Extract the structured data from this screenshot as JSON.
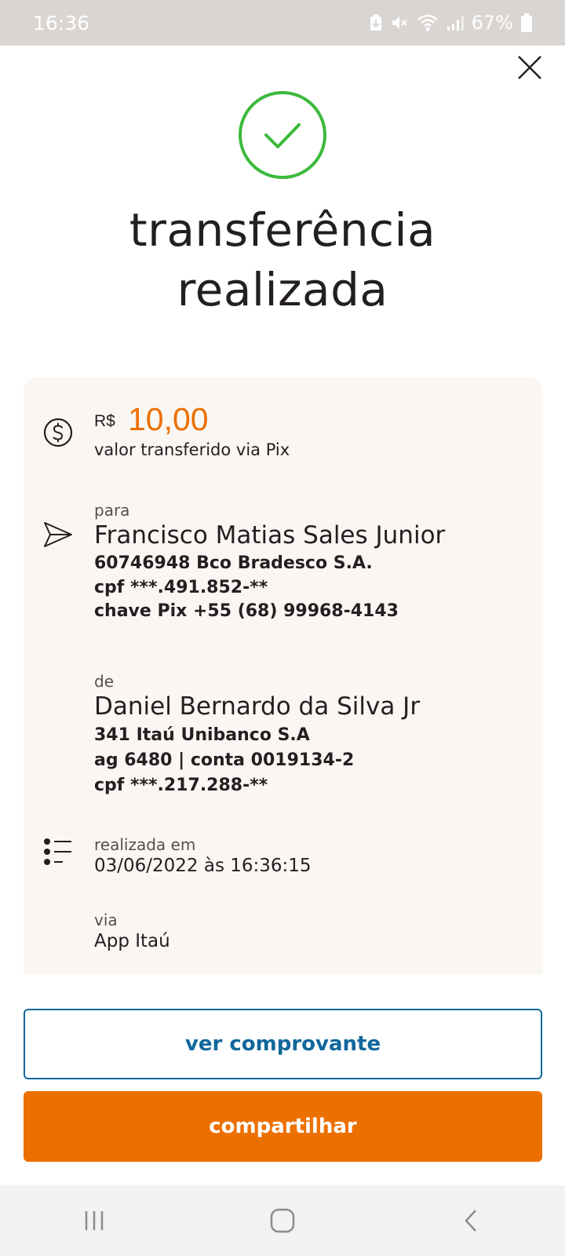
{
  "status_bar": {
    "time": "16:36",
    "battery": "67%",
    "icons": [
      "battery-saver-icon",
      "mute-icon",
      "wifi-icon",
      "signal-icon",
      "battery-icon"
    ]
  },
  "header": {
    "title_line1": "transferência",
    "title_line2": "realizada",
    "close_icon": "close-icon",
    "success_icon": "check-circle-icon"
  },
  "amount": {
    "currency": "R$",
    "value": "10,00",
    "caption": "valor transferido via Pix",
    "icon": "dollar-circle-icon"
  },
  "recipient": {
    "label": "para",
    "name": "Francisco Matias Sales Junior",
    "bank": "60746948 Bco Bradesco S.A.",
    "cpf": "cpf ***.491.852-**",
    "pix_key": "chave Pix +55 (68) 99968-4143",
    "icon": "send-icon"
  },
  "sender": {
    "label": "de",
    "name": "Daniel Bernardo da Silva Jr",
    "bank": "341 Itaú Unibanco S.A",
    "account": "ag 6480 | conta 0019134-2",
    "cpf": "cpf ***.217.288-**"
  },
  "details": {
    "date_label": "realizada em",
    "date_value": "03/06/2022 às 16:36:15",
    "via_label": "via",
    "via_value": "App Itaú",
    "icon": "list-icon"
  },
  "buttons": {
    "receipt": "ver comprovante",
    "share": "compartilhar"
  },
  "colors": {
    "accent": "#ec7000",
    "link": "#10679b",
    "success": "#3cb93c",
    "card_bg": "#f9f6f3"
  },
  "nav_bar": {
    "icons": [
      "recent-apps-icon",
      "home-icon",
      "back-icon"
    ]
  }
}
